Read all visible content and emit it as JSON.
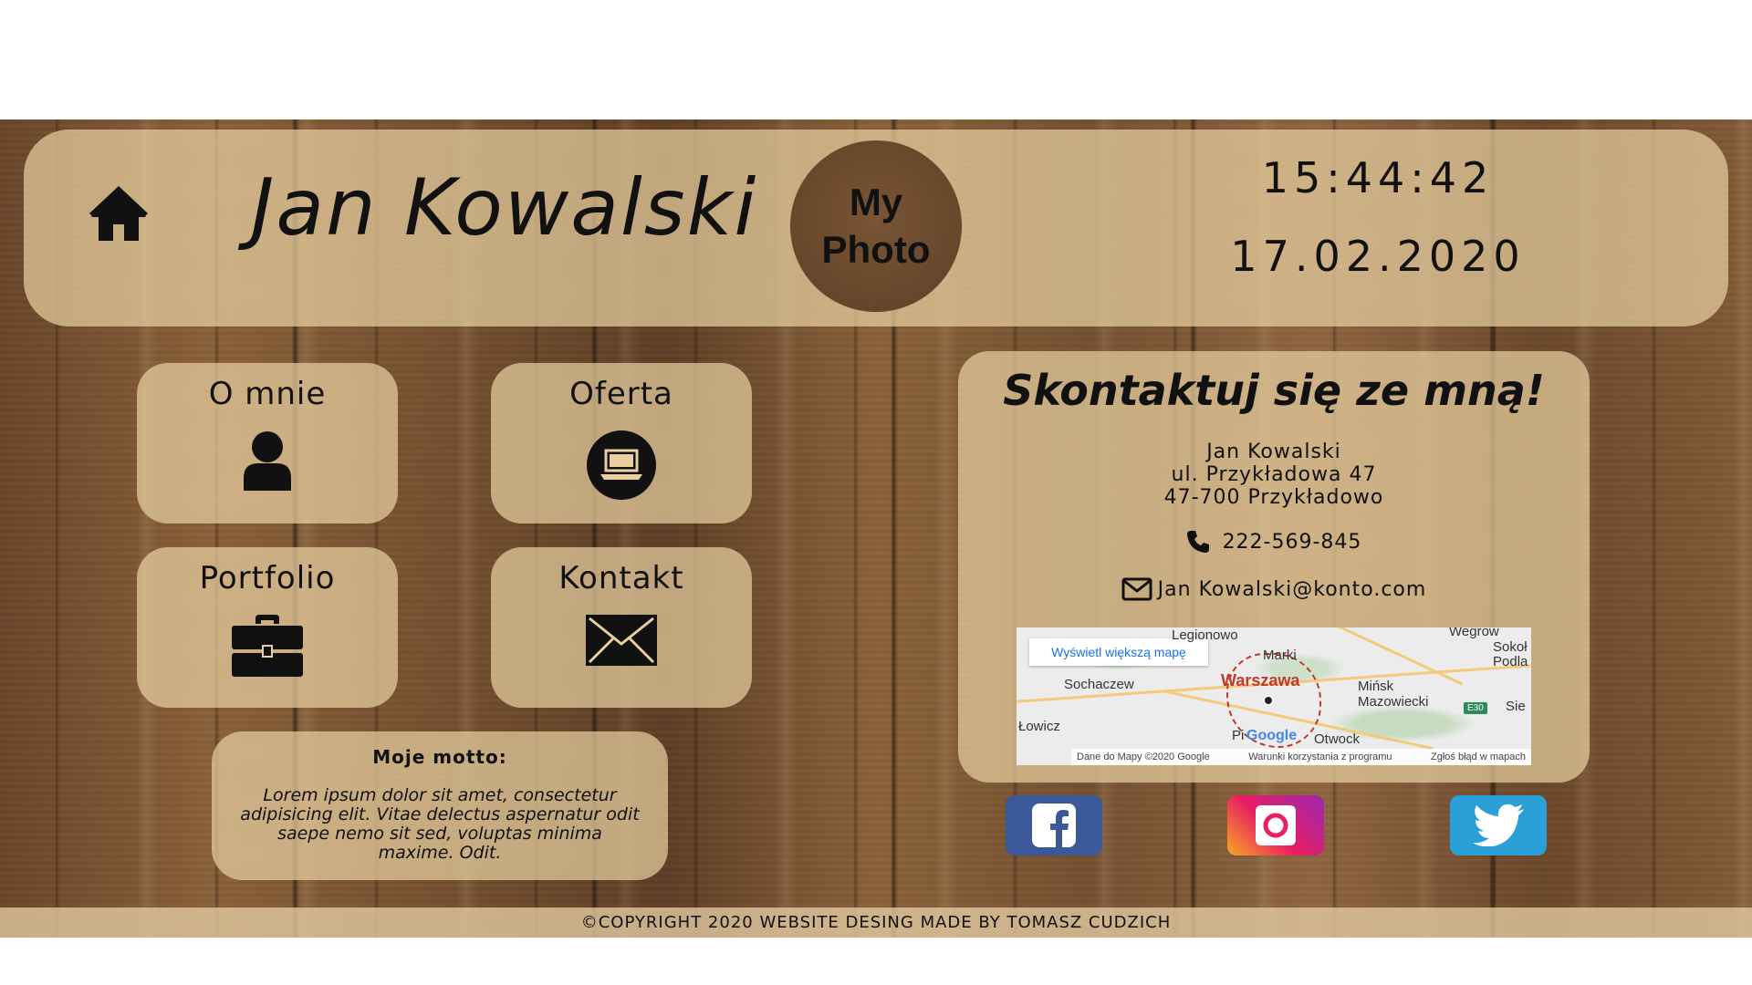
{
  "header": {
    "name": "Jan Kowalski",
    "photo_label": "My Photo",
    "time": "15:44:42",
    "date": "17.02.2020",
    "home_icon": "home-icon"
  },
  "nav": {
    "tiles": [
      {
        "label": "O mnie",
        "icon": "user-icon"
      },
      {
        "label": "Oferta",
        "icon": "laptop-icon"
      },
      {
        "label": "Portfolio",
        "icon": "briefcase-icon"
      },
      {
        "label": "Kontakt",
        "icon": "envelope-icon"
      }
    ]
  },
  "motto": {
    "title": "Moje motto:",
    "text": "Lorem ipsum dolor sit amet, consectetur adipisicing elit. Vitae delectus aspernatur odit saepe nemo sit sed, voluptas minima maxime. Odit."
  },
  "contact": {
    "title": "Skontaktuj się ze mną!",
    "address_line1": "Jan Kowalski",
    "address_line2": "ul. Przykładowa 47",
    "address_line3": "47-700 Przykładowo",
    "phone": "222-569-845",
    "email": "Jan Kowalski@konto.com"
  },
  "map": {
    "larger_map_link": "Wyświetl większą mapę",
    "cities": [
      "Legionowo",
      "Marki",
      "Wegrow",
      "Sokoł Podla",
      "Sochaczew",
      "Warszawa",
      "Mińsk Mazowiecki",
      "Sie",
      "Łowicz",
      "Pi",
      "Otwock"
    ],
    "road_badge": "E30",
    "logo": "Google",
    "footer_data": "Dane do Mapy ©2020 Google",
    "footer_terms": "Warunki korzystania z programu",
    "footer_report": "Zgłoś błąd w mapach"
  },
  "social": {
    "items": [
      {
        "name": "facebook",
        "icon": "facebook-icon",
        "color": "#3b5998"
      },
      {
        "name": "instagram",
        "icon": "instagram-icon",
        "color": "#e91e63"
      },
      {
        "name": "twitter",
        "icon": "twitter-icon",
        "color": "#2a9fd8"
      }
    ]
  },
  "footer": {
    "copyright": "©COPYRIGHT 2020 WEBSITE DESING MADE BY TOMASZ CUDZICH"
  }
}
